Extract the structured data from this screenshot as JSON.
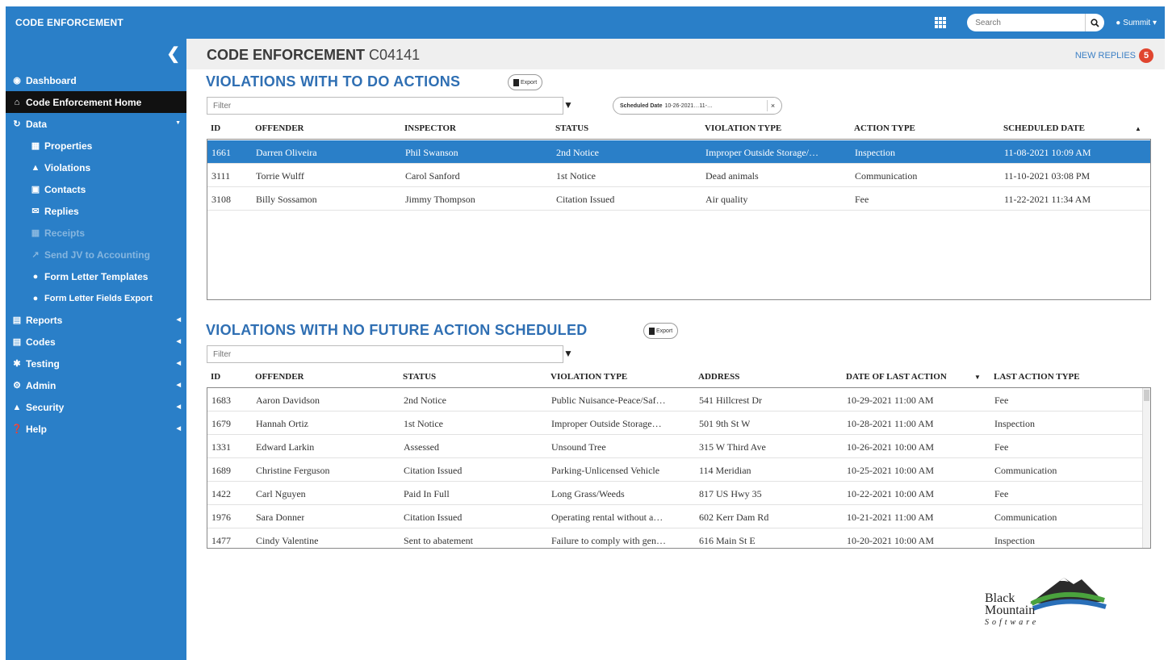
{
  "topbar": {
    "title": "CODE ENFORCEMENT",
    "search_placeholder": "Search",
    "user": "Summit"
  },
  "sidebar": {
    "items": [
      {
        "label": "Dashboard",
        "icon": "dashboard-icon"
      },
      {
        "label": "Code Enforcement Home",
        "icon": "home-icon"
      },
      {
        "label": "Data",
        "icon": "refresh-icon"
      },
      {
        "label": "Properties",
        "icon": "building-icon"
      },
      {
        "label": "Violations",
        "icon": "warning-icon"
      },
      {
        "label": "Contacts",
        "icon": "contact-icon"
      },
      {
        "label": "Replies",
        "icon": "envelope-icon"
      },
      {
        "label": "Receipts",
        "icon": "receipt-icon"
      },
      {
        "label": "Send JV to Accounting",
        "icon": "export-icon"
      },
      {
        "label": "Form Letter Templates",
        "icon": "comment-icon"
      },
      {
        "label": "Form Letter Fields Export",
        "icon": "comment-icon"
      },
      {
        "label": "Reports",
        "icon": "reports-icon"
      },
      {
        "label": "Codes",
        "icon": "codes-icon"
      },
      {
        "label": "Testing",
        "icon": "bug-icon"
      },
      {
        "label": "Admin",
        "icon": "gears-icon"
      },
      {
        "label": "Security",
        "icon": "lock-icon"
      },
      {
        "label": "Help",
        "icon": "help-icon"
      }
    ]
  },
  "header": {
    "title": "CODE ENFORCEMENT",
    "code": "C04141",
    "new_replies_label": "NEW REPLIES",
    "new_replies_count": "5"
  },
  "todo": {
    "title": "VIOLATIONS WITH TO DO ACTIONS",
    "export_label": "Export",
    "filter_placeholder": "Filter",
    "chip_label": "Scheduled Date",
    "chip_value": "10-26-2021…11-…",
    "chip_close": "×",
    "columns": [
      "ID",
      "OFFENDER",
      "INSPECTOR",
      "STATUS",
      "VIOLATION TYPE",
      "ACTION TYPE",
      "SCHEDULED DATE"
    ],
    "sort_indicator": "▲",
    "rows": [
      [
        "1661",
        "Darren Oliveira",
        "Phil Swanson",
        "2nd Notice",
        "Improper Outside Storage/…",
        "Inspection",
        "11-08-2021 10:09 AM"
      ],
      [
        "3111",
        "Torrie Wulff",
        "Carol Sanford",
        "1st Notice",
        "Dead animals",
        "Communication",
        "11-10-2021 03:08 PM"
      ],
      [
        "3108",
        "Billy Sossamon",
        "Jimmy Thompson",
        "Citation Issued",
        "Air quality",
        "Fee",
        "11-22-2021 11:34 AM"
      ]
    ]
  },
  "nofuture": {
    "title": "VIOLATIONS WITH NO FUTURE ACTION SCHEDULED",
    "export_label": "Export",
    "filter_placeholder": "Filter",
    "columns": [
      "ID",
      "OFFENDER",
      "STATUS",
      "VIOLATION TYPE",
      "ADDRESS",
      "DATE OF LAST ACTION",
      "LAST ACTION TYPE"
    ],
    "sort_indicator": "▼",
    "rows": [
      [
        "1683",
        "Aaron Davidson",
        "2nd Notice",
        "Public Nuisance-Peace/Saf…",
        "541 Hillcrest Dr",
        "10-29-2021 11:00 AM",
        "Fee"
      ],
      [
        "1679",
        "Hannah Ortiz",
        "1st Notice",
        "Improper Outside Storage…",
        "501 9th St W",
        "10-28-2021 11:00 AM",
        "Inspection"
      ],
      [
        "1331",
        "Edward Larkin",
        "Assessed",
        "Unsound Tree",
        "315 W Third Ave",
        "10-26-2021 10:00 AM",
        "Fee"
      ],
      [
        "1689",
        "Christine Ferguson",
        "Citation Issued",
        "Parking-Unlicensed Vehicle",
        "114 Meridian",
        "10-25-2021 10:00 AM",
        "Communication"
      ],
      [
        "1422",
        "Carl Nguyen",
        "Paid In Full",
        "Long Grass/Weeds",
        "817 US Hwy 35",
        "10-22-2021 10:00 AM",
        "Fee"
      ],
      [
        "1976",
        "Sara Donner",
        "Citation Issued",
        "Operating rental without a…",
        "602 Kerr Dam Rd",
        "10-21-2021 11:00 AM",
        "Communication"
      ],
      [
        "1477",
        "Cindy Valentine",
        "Sent to abatement",
        "Failure to comply with gen…",
        "616 Main St E",
        "10-20-2021 10:00 AM",
        "Inspection"
      ]
    ]
  },
  "logo": {
    "line1": "Black",
    "line2": "Mountain",
    "line3": "Software"
  }
}
